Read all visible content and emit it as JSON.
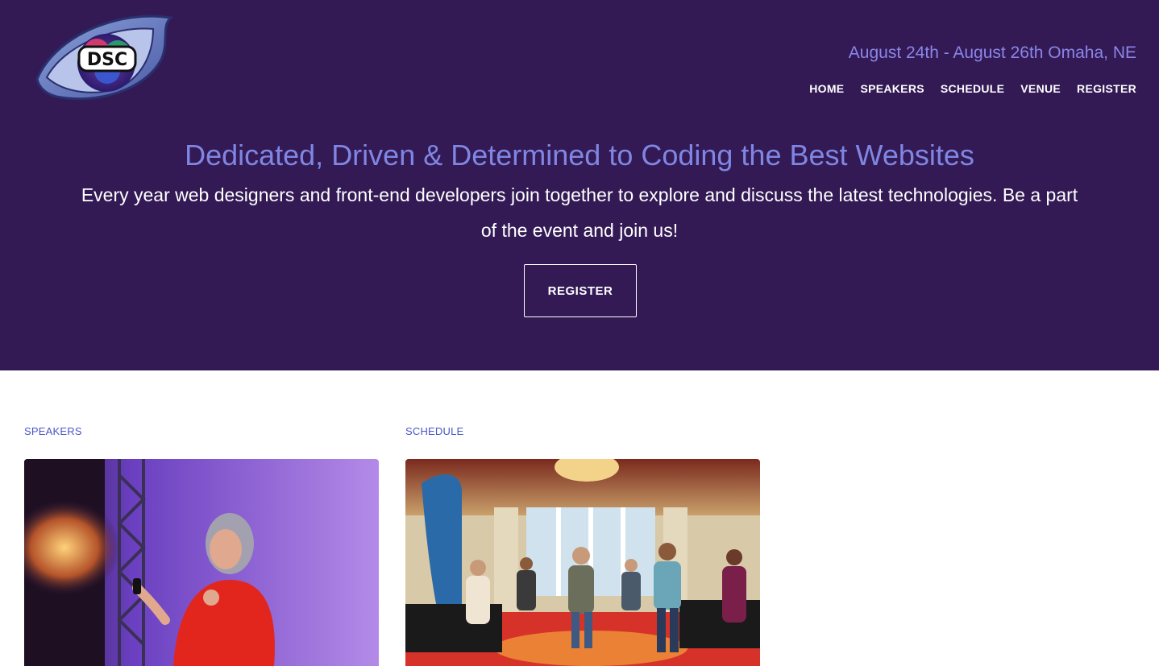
{
  "header": {
    "logo_text": "DSC",
    "dates": "August 24th - August 26th Omaha, NE",
    "nav": [
      {
        "label": "HOME"
      },
      {
        "label": "SPEAKERS"
      },
      {
        "label": "SCHEDULE"
      },
      {
        "label": "VENUE"
      },
      {
        "label": "REGISTER"
      }
    ]
  },
  "hero": {
    "title": "Dedicated, Driven & Determined to Coding the Best Websites",
    "subtitle": "Every year web designers and front-end developers join together to explore and discuss the latest technologies. Be a part of the event and join us!",
    "register_label": "REGISTER"
  },
  "sections": [
    {
      "label": "SPEAKERS",
      "image": "speaker-on-stage-photo"
    },
    {
      "label": "SCHEDULE",
      "image": "conference-hall-crowd-photo"
    }
  ],
  "colors": {
    "hero_background": "#331a55",
    "accent": "#7f86e3",
    "link": "#4a55c8"
  }
}
